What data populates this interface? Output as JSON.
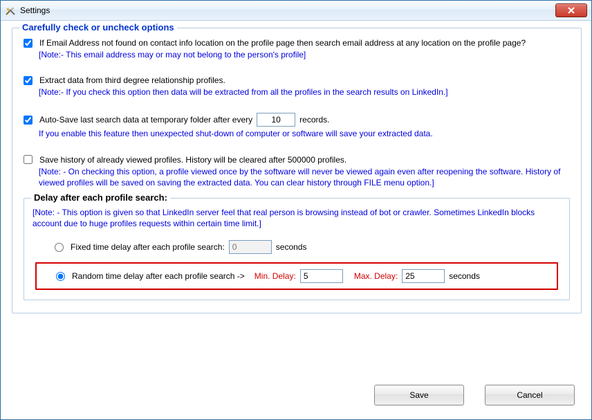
{
  "window_title": "Settings",
  "group_title": "Carefully check or uncheck options",
  "opt1": {
    "checked": true,
    "label": "If Email Address not found on contact info location on the profile page then search email address at any location on the profile page?",
    "note": "[Note:- This email address may or may not belong to the person's profile]"
  },
  "opt2": {
    "checked": true,
    "label": "Extract data from third degree relationship profiles.",
    "note": "[Note:- If you check this option then data will be extracted from all the profiles in the search results on LinkedIn.]"
  },
  "opt3": {
    "checked": true,
    "label_pre": "Auto-Save last search data at temporary folder after every",
    "value": "10",
    "label_post": "records.",
    "note": "If you enable this feature then unexpected shut-down of computer or software will save your extracted data."
  },
  "opt4": {
    "checked": false,
    "label": "Save history of already viewed profiles. History will be cleared after 500000 profiles.",
    "note": "[Note: - On checking this option, a profile viewed once by the software will never be viewed again even after reopening the software. History of viewed profiles will be saved on saving the extracted data. You can clear history through FILE menu option.]"
  },
  "delay": {
    "title": "Delay after each profile search:",
    "note": "[Note: - This option is given so that LinkedIn server feel that real person is browsing instead of bot or crawler. Sometimes LinkedIn blocks account due to huge profiles requests within certain time limit.]",
    "fixed": {
      "selected": false,
      "label": "Fixed time delay after each profile search:",
      "value": "0",
      "unit": "seconds"
    },
    "random": {
      "selected": true,
      "label": "Random time delay after each profile search ->",
      "min_label": "Min. Delay:",
      "min_value": "5",
      "max_label": "Max. Delay:",
      "max_value": "25",
      "unit": "seconds"
    }
  },
  "buttons": {
    "save": "Save",
    "cancel": "Cancel"
  }
}
